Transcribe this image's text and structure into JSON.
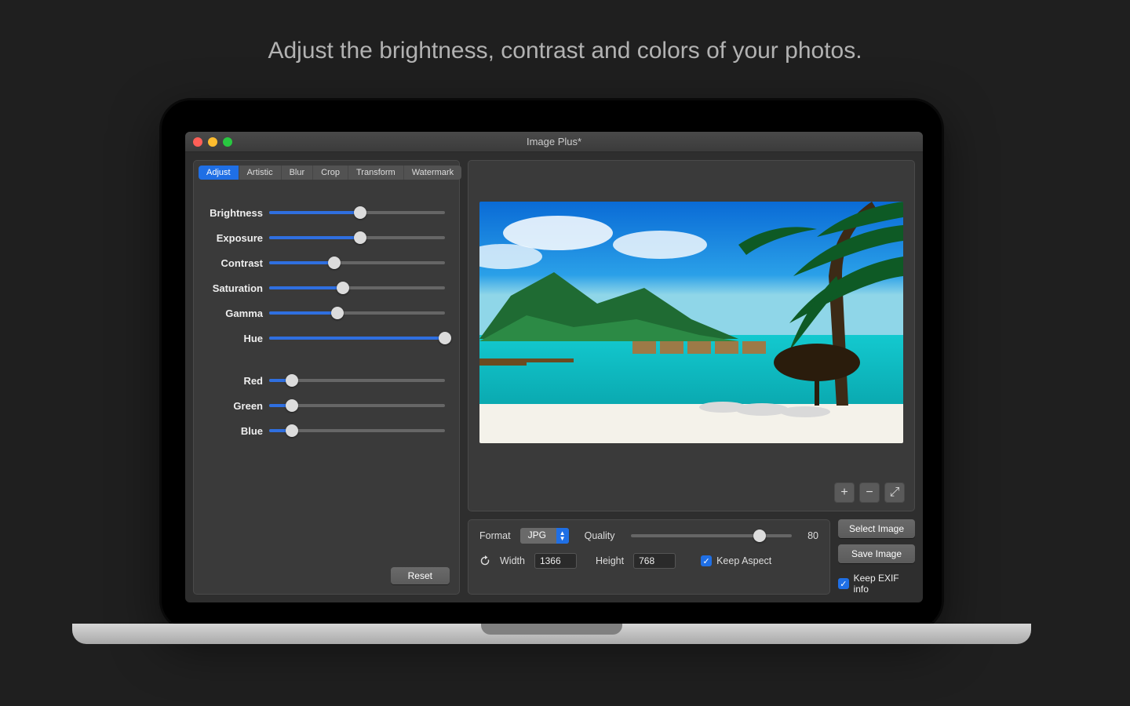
{
  "headline": "Adjust the brightness, contrast and colors of your photos.",
  "window": {
    "title": "Image Plus*"
  },
  "tabs": [
    "Adjust",
    "Artistic",
    "Blur",
    "Crop",
    "Transform",
    "Watermark"
  ],
  "activeTab": 0,
  "sliders": {
    "group1": [
      {
        "label": "Brightness",
        "pct": 52
      },
      {
        "label": "Exposure",
        "pct": 52
      },
      {
        "label": "Contrast",
        "pct": 37
      },
      {
        "label": "Saturation",
        "pct": 42
      },
      {
        "label": "Gamma",
        "pct": 39
      },
      {
        "label": "Hue",
        "pct": 100
      }
    ],
    "group2": [
      {
        "label": "Red",
        "pct": 13
      },
      {
        "label": "Green",
        "pct": 13
      },
      {
        "label": "Blue",
        "pct": 13
      }
    ]
  },
  "reset_label": "Reset",
  "zoom_icons": {
    "plus": "+",
    "minus": "−",
    "expand": "⤢"
  },
  "output": {
    "format_label": "Format",
    "format_value": "JPG",
    "quality_label": "Quality",
    "quality_value": "80",
    "quality_pct": 80,
    "width_label": "Width",
    "width_value": "1366",
    "height_label": "Height",
    "height_value": "768",
    "keep_aspect_label": "Keep Aspect",
    "keep_aspect_checked": true
  },
  "actions": {
    "select": "Select Image",
    "save": "Save Image",
    "keep_exif_label": "Keep EXIF info",
    "keep_exif_checked": true
  }
}
